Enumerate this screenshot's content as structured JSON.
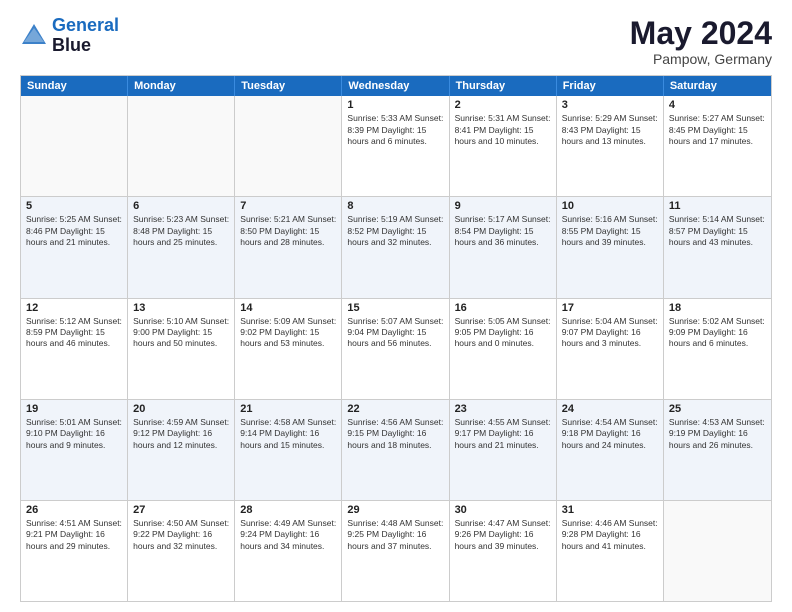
{
  "logo": {
    "line1": "General",
    "line2": "Blue"
  },
  "title": "May 2024",
  "location": "Pampow, Germany",
  "days": [
    "Sunday",
    "Monday",
    "Tuesday",
    "Wednesday",
    "Thursday",
    "Friday",
    "Saturday"
  ],
  "rows": [
    [
      {
        "day": "",
        "text": ""
      },
      {
        "day": "",
        "text": ""
      },
      {
        "day": "",
        "text": ""
      },
      {
        "day": "1",
        "text": "Sunrise: 5:33 AM\nSunset: 8:39 PM\nDaylight: 15 hours\nand 6 minutes."
      },
      {
        "day": "2",
        "text": "Sunrise: 5:31 AM\nSunset: 8:41 PM\nDaylight: 15 hours\nand 10 minutes."
      },
      {
        "day": "3",
        "text": "Sunrise: 5:29 AM\nSunset: 8:43 PM\nDaylight: 15 hours\nand 13 minutes."
      },
      {
        "day": "4",
        "text": "Sunrise: 5:27 AM\nSunset: 8:45 PM\nDaylight: 15 hours\nand 17 minutes."
      }
    ],
    [
      {
        "day": "5",
        "text": "Sunrise: 5:25 AM\nSunset: 8:46 PM\nDaylight: 15 hours\nand 21 minutes."
      },
      {
        "day": "6",
        "text": "Sunrise: 5:23 AM\nSunset: 8:48 PM\nDaylight: 15 hours\nand 25 minutes."
      },
      {
        "day": "7",
        "text": "Sunrise: 5:21 AM\nSunset: 8:50 PM\nDaylight: 15 hours\nand 28 minutes."
      },
      {
        "day": "8",
        "text": "Sunrise: 5:19 AM\nSunset: 8:52 PM\nDaylight: 15 hours\nand 32 minutes."
      },
      {
        "day": "9",
        "text": "Sunrise: 5:17 AM\nSunset: 8:54 PM\nDaylight: 15 hours\nand 36 minutes."
      },
      {
        "day": "10",
        "text": "Sunrise: 5:16 AM\nSunset: 8:55 PM\nDaylight: 15 hours\nand 39 minutes."
      },
      {
        "day": "11",
        "text": "Sunrise: 5:14 AM\nSunset: 8:57 PM\nDaylight: 15 hours\nand 43 minutes."
      }
    ],
    [
      {
        "day": "12",
        "text": "Sunrise: 5:12 AM\nSunset: 8:59 PM\nDaylight: 15 hours\nand 46 minutes."
      },
      {
        "day": "13",
        "text": "Sunrise: 5:10 AM\nSunset: 9:00 PM\nDaylight: 15 hours\nand 50 minutes."
      },
      {
        "day": "14",
        "text": "Sunrise: 5:09 AM\nSunset: 9:02 PM\nDaylight: 15 hours\nand 53 minutes."
      },
      {
        "day": "15",
        "text": "Sunrise: 5:07 AM\nSunset: 9:04 PM\nDaylight: 15 hours\nand 56 minutes."
      },
      {
        "day": "16",
        "text": "Sunrise: 5:05 AM\nSunset: 9:05 PM\nDaylight: 16 hours\nand 0 minutes."
      },
      {
        "day": "17",
        "text": "Sunrise: 5:04 AM\nSunset: 9:07 PM\nDaylight: 16 hours\nand 3 minutes."
      },
      {
        "day": "18",
        "text": "Sunrise: 5:02 AM\nSunset: 9:09 PM\nDaylight: 16 hours\nand 6 minutes."
      }
    ],
    [
      {
        "day": "19",
        "text": "Sunrise: 5:01 AM\nSunset: 9:10 PM\nDaylight: 16 hours\nand 9 minutes."
      },
      {
        "day": "20",
        "text": "Sunrise: 4:59 AM\nSunset: 9:12 PM\nDaylight: 16 hours\nand 12 minutes."
      },
      {
        "day": "21",
        "text": "Sunrise: 4:58 AM\nSunset: 9:14 PM\nDaylight: 16 hours\nand 15 minutes."
      },
      {
        "day": "22",
        "text": "Sunrise: 4:56 AM\nSunset: 9:15 PM\nDaylight: 16 hours\nand 18 minutes."
      },
      {
        "day": "23",
        "text": "Sunrise: 4:55 AM\nSunset: 9:17 PM\nDaylight: 16 hours\nand 21 minutes."
      },
      {
        "day": "24",
        "text": "Sunrise: 4:54 AM\nSunset: 9:18 PM\nDaylight: 16 hours\nand 24 minutes."
      },
      {
        "day": "25",
        "text": "Sunrise: 4:53 AM\nSunset: 9:19 PM\nDaylight: 16 hours\nand 26 minutes."
      }
    ],
    [
      {
        "day": "26",
        "text": "Sunrise: 4:51 AM\nSunset: 9:21 PM\nDaylight: 16 hours\nand 29 minutes."
      },
      {
        "day": "27",
        "text": "Sunrise: 4:50 AM\nSunset: 9:22 PM\nDaylight: 16 hours\nand 32 minutes."
      },
      {
        "day": "28",
        "text": "Sunrise: 4:49 AM\nSunset: 9:24 PM\nDaylight: 16 hours\nand 34 minutes."
      },
      {
        "day": "29",
        "text": "Sunrise: 4:48 AM\nSunset: 9:25 PM\nDaylight: 16 hours\nand 37 minutes."
      },
      {
        "day": "30",
        "text": "Sunrise: 4:47 AM\nSunset: 9:26 PM\nDaylight: 16 hours\nand 39 minutes."
      },
      {
        "day": "31",
        "text": "Sunrise: 4:46 AM\nSunset: 9:28 PM\nDaylight: 16 hours\nand 41 minutes."
      },
      {
        "day": "",
        "text": ""
      }
    ]
  ]
}
